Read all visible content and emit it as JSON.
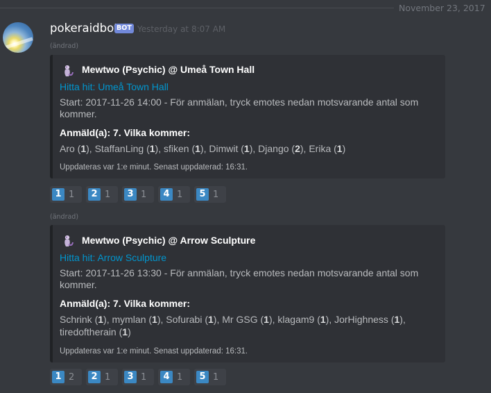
{
  "date_divider": "November 23, 2017",
  "message": {
    "username": "pokeraidbot",
    "bot_tag": "BOT",
    "timestamp": "Yesterday at 8:07 AM",
    "avatar_icon": "sun-flare-avatar"
  },
  "embeds": [
    {
      "edited": "(ändrad)",
      "author_icon": "mewtwo-icon",
      "author": "Mewtwo (Psychic) @ Umeå Town Hall",
      "link": "Hitta hit: Umeå Town Hall",
      "description": "Start: 2017-11-26 14:00 - För anmälan, tryck emotes nedan motsvarande antal som kommer.",
      "field_name": "Anmäld(a): 7. Vilka kommer:",
      "attendees": [
        {
          "name": "Aro",
          "count": "1"
        },
        {
          "name": "StaffanLing",
          "count": "1"
        },
        {
          "name": "sfiken",
          "count": "1"
        },
        {
          "name": "Dimwit",
          "count": "1"
        },
        {
          "name": "Django",
          "count": "2"
        },
        {
          "name": "Erika",
          "count": "1"
        }
      ],
      "footer": "Uppdateras var 1:e minut. Senast uppdaterad: 16:31.",
      "reactions": [
        {
          "emoji": "1",
          "count": "1"
        },
        {
          "emoji": "2",
          "count": "1"
        },
        {
          "emoji": "3",
          "count": "1"
        },
        {
          "emoji": "4",
          "count": "1"
        },
        {
          "emoji": "5",
          "count": "1"
        }
      ]
    },
    {
      "edited": "(ändrad)",
      "author_icon": "mewtwo-icon",
      "author": "Mewtwo (Psychic) @ Arrow Sculpture",
      "link": "Hitta hit: Arrow Sculpture",
      "description": "Start: 2017-11-26 13:30 - För anmälan, tryck emotes nedan motsvarande antal som kommer.",
      "field_name": "Anmäld(a): 7. Vilka kommer:",
      "attendees": [
        {
          "name": "Schrink",
          "count": "1"
        },
        {
          "name": "mymlan",
          "count": "1"
        },
        {
          "name": "Sofurabi",
          "count": "1"
        },
        {
          "name": "Mr GSG",
          "count": "1"
        },
        {
          "name": "klagam9",
          "count": "1"
        },
        {
          "name": "JorHighness",
          "count": "1"
        },
        {
          "name": "tiredoftherain",
          "count": "1"
        }
      ],
      "footer": "Uppdateras var 1:e minut. Senast uppdaterad: 16:31.",
      "reactions": [
        {
          "emoji": "1",
          "count": "2"
        },
        {
          "emoji": "2",
          "count": "1"
        },
        {
          "emoji": "3",
          "count": "1"
        },
        {
          "emoji": "4",
          "count": "1"
        },
        {
          "emoji": "5",
          "count": "1"
        }
      ]
    }
  ]
}
